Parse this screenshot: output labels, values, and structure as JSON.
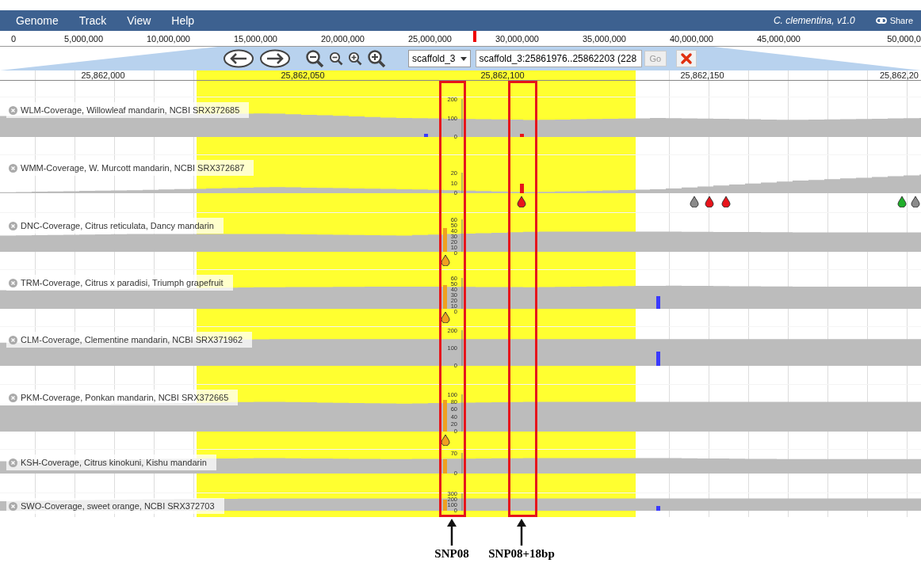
{
  "menu": {
    "items": [
      "Genome",
      "Track",
      "View",
      "Help"
    ],
    "genome": "C. clementina, v1.0",
    "share": "Share"
  },
  "overview_ruler": {
    "ticks": [
      "0",
      "5,000,000",
      "10,000,000",
      "15,000,000",
      "20,000,000",
      "25,000,000",
      "30,000,000",
      "35,000,000",
      "40,000,000",
      "45,000,000",
      "50,000,0"
    ]
  },
  "navigation": {
    "reference": "scaffold_3",
    "location": "scaffold_3:25861976..25862203 (228",
    "go": "Go"
  },
  "detail_ruler": {
    "ticks": [
      "25,862,000",
      "25,862,050",
      "25,862,100",
      "25,862,150",
      "25,862,20"
    ]
  },
  "tracks": [
    {
      "label": "WLM-Coverage, Willowleaf mandarin, NCBI SRX372685",
      "scale": [
        "200",
        "100",
        "0"
      ]
    },
    {
      "label": "WMM-Coverage, W. Murcott mandarin, NCBI SRX372687",
      "scale": [
        "20",
        "10",
        "0"
      ],
      "variants": [
        {
          "color": "#e8141b"
        },
        {
          "color": "#8a8a8a"
        },
        {
          "color": "#e8141b"
        },
        {
          "color": "#e8141b"
        },
        {
          "color": "#1fae2a"
        },
        {
          "color": "#8a8a8a"
        }
      ]
    },
    {
      "label": "DNC-Coverage, Citrus reticulata, Dancy mandarin",
      "scale": [
        "60",
        "50",
        "40",
        "30",
        "20",
        "10",
        "0"
      ],
      "variants": [
        {
          "color": "#f0a020"
        }
      ]
    },
    {
      "label": "TRM-Coverage, Citrus x paradisi, Triumph grapefruit",
      "scale": [
        "60",
        "50",
        "40",
        "30",
        "20",
        "10",
        "0"
      ],
      "variants": [
        {
          "color": "#f0a020"
        }
      ]
    },
    {
      "label": "CLM-Coverage, Clementine mandarin, NCBI SRX371962",
      "scale": [
        "200",
        "100",
        "0"
      ]
    },
    {
      "label": "PKM-Coverage, Ponkan mandarin, NCBI SRX372665",
      "scale": [
        "100",
        "80",
        "60",
        "40",
        "20",
        "0"
      ],
      "variants": [
        {
          "color": "#f0a020"
        }
      ]
    },
    {
      "label": "KSH-Coverage, Citrus kinokuni, Kishu mandarin",
      "scale": [
        "70",
        "0"
      ]
    },
    {
      "label": "SWO-Coverage, sweet orange, NCBI SRX372703",
      "scale": [
        "300",
        "200",
        "100",
        "0"
      ]
    }
  ],
  "annotations": [
    {
      "label": "SNP08"
    },
    {
      "label": "SNP08+18bp"
    }
  ]
}
